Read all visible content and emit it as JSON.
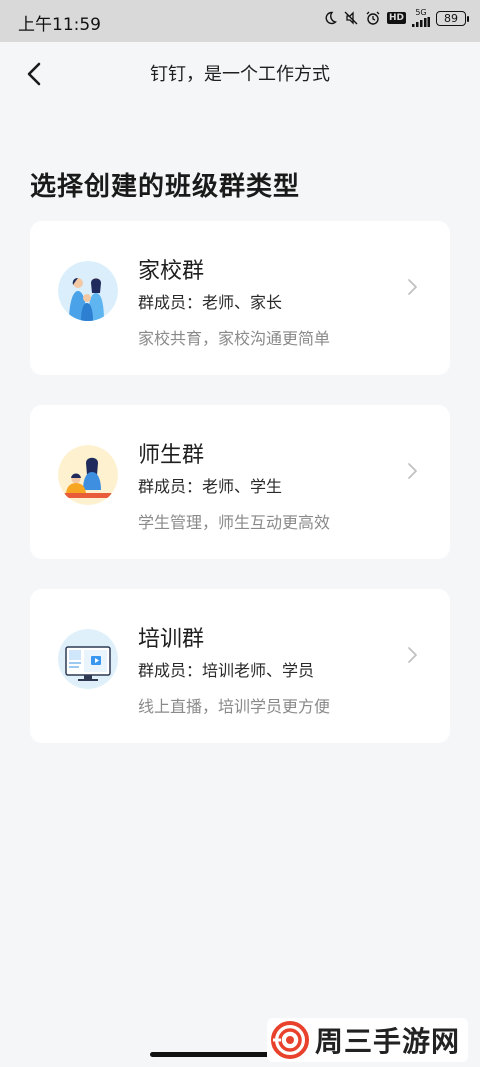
{
  "status": {
    "time": "上午11:59",
    "network": "5G",
    "battery": "89"
  },
  "nav": {
    "title": "钉钉，是一个工作方式"
  },
  "page": {
    "heading": "选择创建的班级群类型"
  },
  "cards": [
    {
      "name": "家校群",
      "members": "群成员：老师、家长",
      "desc": "家校共育，家校沟通更简单",
      "icon": "family-illustration"
    },
    {
      "name": "师生群",
      "members": "群成员：老师、学生",
      "desc": "学生管理，师生互动更高效",
      "icon": "teacher-student-illustration"
    },
    {
      "name": "培训群",
      "members": "群成员：培训老师、学员",
      "desc": "线上直播，培训学员更方便",
      "icon": "training-screen-illustration"
    }
  ],
  "watermark": {
    "text": "周三手游网"
  },
  "colors": {
    "background": "#f5f6f7",
    "card": "#ffffff",
    "status_bar": "#d9d9d9",
    "desc_text": "#8a8a8a",
    "watermark_red": "#e8412c"
  }
}
